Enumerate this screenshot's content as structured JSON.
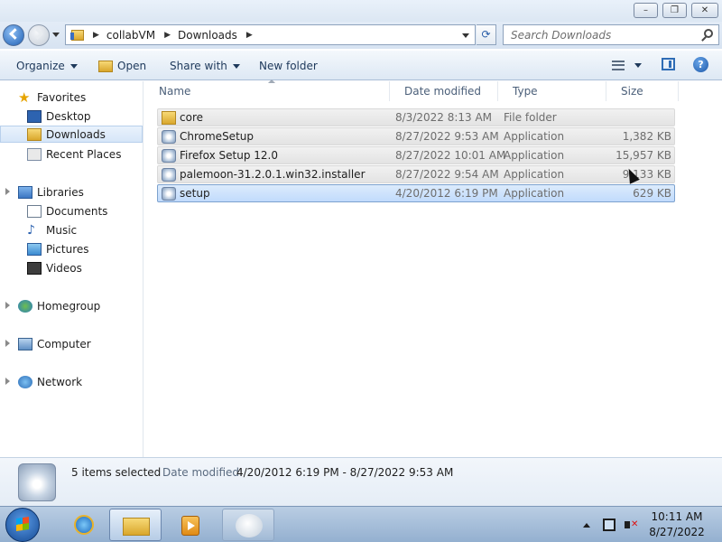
{
  "window": {
    "controls": {
      "minimize": "–",
      "maximize": "❐",
      "close": "✕"
    }
  },
  "nav": {
    "breadcrumb": [
      "collabVM",
      "Downloads"
    ],
    "search_placeholder": "Search Downloads",
    "refresh_glyph": "⟳"
  },
  "toolbar": {
    "organize": "Organize",
    "open": "Open",
    "share_with": "Share with",
    "new_folder": "New folder",
    "help": "?"
  },
  "sidebar": {
    "favorites": {
      "label": "Favorites",
      "items": [
        "Desktop",
        "Downloads",
        "Recent Places"
      ]
    },
    "libraries": {
      "label": "Libraries",
      "items": [
        "Documents",
        "Music",
        "Pictures",
        "Videos"
      ]
    },
    "homegroup": "Homegroup",
    "computer": "Computer",
    "network": "Network",
    "selected": "Downloads"
  },
  "columns": {
    "name": "Name",
    "date": "Date modified",
    "type": "Type",
    "size": "Size"
  },
  "files": [
    {
      "name": "core",
      "date": "8/3/2022 8:13 AM",
      "type": "File folder",
      "size": "",
      "icon": "folder-icon",
      "state": "selected"
    },
    {
      "name": "ChromeSetup",
      "date": "8/27/2022 9:53 AM",
      "type": "Application",
      "size": "1,382 KB",
      "icon": "application-icon",
      "state": "selected"
    },
    {
      "name": "Firefox Setup 12.0",
      "date": "8/27/2022 10:01 AM",
      "type": "Application",
      "size": "15,957 KB",
      "icon": "application-icon",
      "state": "selected"
    },
    {
      "name": "palemoon-31.2.0.1.win32.installer",
      "date": "8/27/2022 9:54 AM",
      "type": "Application",
      "size": "9,133 KB",
      "icon": "application-icon",
      "state": "selected"
    },
    {
      "name": "setup",
      "date": "4/20/2012 6:19 PM",
      "type": "Application",
      "size": "629 KB",
      "icon": "application-icon",
      "state": "focused"
    }
  ],
  "details": {
    "count": "5 items selected",
    "date_label": "Date modified:",
    "date_value": "4/20/2012 6:19 PM - 8/27/2022 9:53 AM"
  },
  "taskbar": {
    "pinned": [
      "internet-explorer-icon",
      "windows-explorer-icon",
      "media-player-icon",
      "blank-app-icon"
    ],
    "active": "windows-explorer-icon",
    "time": "10:11 AM",
    "date": "8/27/2022"
  },
  "colors": {
    "selection": "#c1dbfc",
    "selection_border": "#7da2ce",
    "toolbar_text": "#1e395b",
    "taskbar": "#94b0d0"
  }
}
